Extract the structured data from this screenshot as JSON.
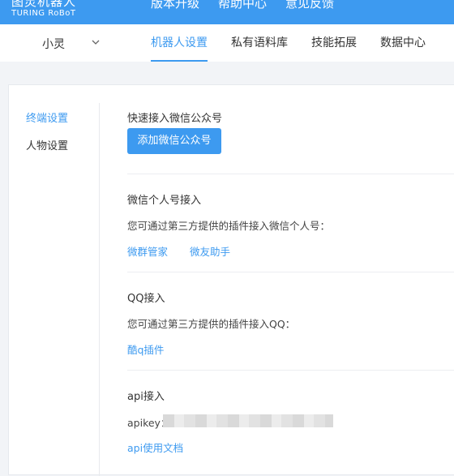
{
  "header": {
    "logo_cn": "图灵机器人",
    "logo_en": "TURING RoBoT",
    "nav": [
      "版本升级",
      "帮助中心",
      "意见反馈"
    ]
  },
  "subnav": {
    "bot_name": "小灵",
    "tabs": [
      "机器人设置",
      "私有语料库",
      "技能拓展",
      "数据中心"
    ],
    "active_tab": "机器人设置"
  },
  "sidebar": {
    "items": [
      "终端设置",
      "人物设置"
    ],
    "active": "终端设置"
  },
  "sections": {
    "wechat_public": {
      "title": "快速接入微信公众号",
      "button": "添加微信公众号"
    },
    "wechat_personal": {
      "title": "微信个人号接入",
      "desc": "您可通过第三方提供的插件接入微信个人号：",
      "links": [
        "微群管家",
        "微友助手"
      ]
    },
    "qq": {
      "title": "QQ接入",
      "desc": "您可通过第三方提供的插件接入QQ：",
      "links": [
        "酷q插件"
      ]
    },
    "api": {
      "title": "api接入",
      "apikey_label": "apikey：",
      "doc_link": "api使用文档"
    }
  },
  "colors": {
    "accent": "#3d9af0",
    "page_bg": "#f2f4f7"
  }
}
